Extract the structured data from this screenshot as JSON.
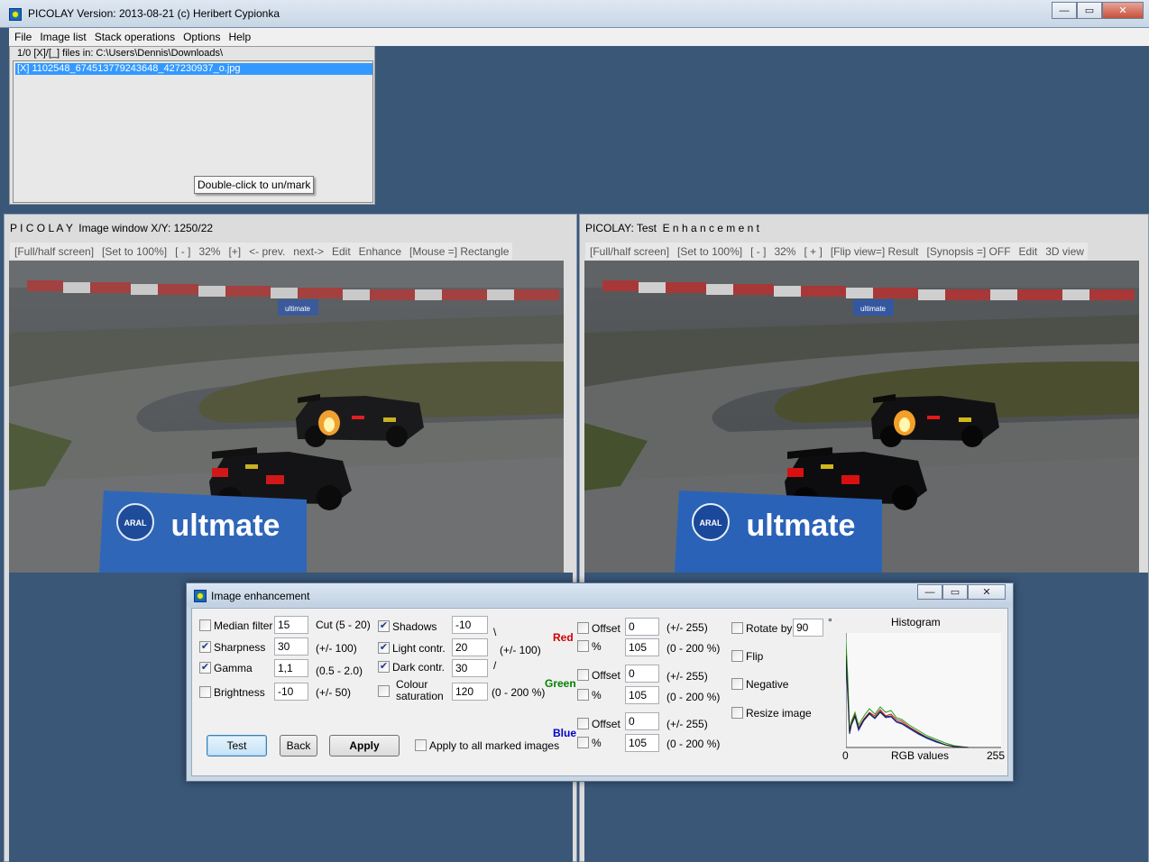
{
  "app": {
    "title": "PICOLAY  Version: 2013-08-21  (c) Heribert Cypionka",
    "window_buttons": {
      "minimize": "—",
      "maximize": "▭",
      "close": "✕"
    }
  },
  "menu": [
    "File",
    "Image list",
    "Stack operations",
    "Options",
    "Help"
  ],
  "file_list": {
    "path_line": "1/0 [X]/[_] files in: C:\\Users\\Dennis\\Downloads\\",
    "selected_file": "[X] 1102548_674513779243648_427230937_o.jpg",
    "tooltip": "Double-click to un/mark"
  },
  "image_window": {
    "title": "P I C O L A Y  Image window X/Y: 1250/22",
    "toolbar": [
      "[Full/half screen]",
      "[Set to 100%]",
      "[ - ]",
      "32%",
      "[+]",
      "<- prev.",
      "next->",
      "Edit",
      "Enhance",
      "[Mouse =] Rectangle"
    ]
  },
  "test_window": {
    "title": "PICOLAY: Test  E n h a n c e m e n t",
    "toolbar": [
      "[Full/half screen]",
      "[Set to 100%]",
      "[ - ]",
      "32%",
      "[ + ]",
      "[Flip view=] Result",
      "[Synopsis =] OFF",
      "Edit",
      "3D view"
    ]
  },
  "photo": {
    "banner_small": "ultimate",
    "banner_main": "ultmate",
    "banner_logo": "ARAL"
  },
  "dialog": {
    "title": "Image enhancement",
    "median_filter": {
      "label": "Median filter",
      "checked": false,
      "value": "15",
      "hint": "Cut (5 - 20)"
    },
    "sharpness": {
      "label": "Sharpness",
      "checked": true,
      "value": "30",
      "hint": "(+/- 100)"
    },
    "gamma": {
      "label": "Gamma",
      "checked": true,
      "value": "1,1",
      "hint": "(0.5 - 2.0)"
    },
    "brightness": {
      "label": "Brightness",
      "checked": false,
      "value": "-10",
      "hint": "(+/- 50)"
    },
    "shadows": {
      "label": "Shadows",
      "checked": true,
      "value": "-10",
      "mark": "\\"
    },
    "light_contr": {
      "label": "Light contr.",
      "checked": true,
      "value": "20",
      "hint": "(+/- 100)"
    },
    "dark_contr": {
      "label": "Dark contr.",
      "checked": true,
      "value": "30",
      "mark": "/"
    },
    "colour_sat": {
      "label1": "Colour",
      "label2": "saturation",
      "checked": false,
      "value": "120",
      "hint": "(0 - 200 %)"
    },
    "channels": [
      {
        "name": "Red",
        "color": "#d00000",
        "offset_label": "Offset",
        "offset": "0",
        "offset_hint": "(+/- 255)",
        "pct_label": "%",
        "pct": "105",
        "pct_hint": "(0 - 200 %)"
      },
      {
        "name": "Green",
        "color": "#008000",
        "offset_label": "Offset",
        "offset": "0",
        "offset_hint": "(+/- 255)",
        "pct_label": "%",
        "pct": "105",
        "pct_hint": "(0 - 200 %)"
      },
      {
        "name": "Blue",
        "color": "#0000c8",
        "offset_label": "Offset",
        "offset": "0",
        "offset_hint": "(+/- 255)",
        "pct_label": "%",
        "pct": "105",
        "pct_hint": "(0 - 200 %)"
      }
    ],
    "rotate": {
      "label": "Rotate by",
      "checked": false,
      "value": "90",
      "unit": "°"
    },
    "flip": {
      "label": "Flip",
      "checked": false
    },
    "negative": {
      "label": "Negative",
      "checked": false
    },
    "resize": {
      "label": "Resize image",
      "checked": false
    },
    "buttons": {
      "test": "Test",
      "back": "Back",
      "apply": "Apply"
    },
    "apply_all": {
      "label": "Apply to all marked images",
      "checked": false
    },
    "histogram": {
      "title": "Histogram",
      "xlabel": "RGB values",
      "xmin": "0",
      "xmax": "255"
    }
  }
}
